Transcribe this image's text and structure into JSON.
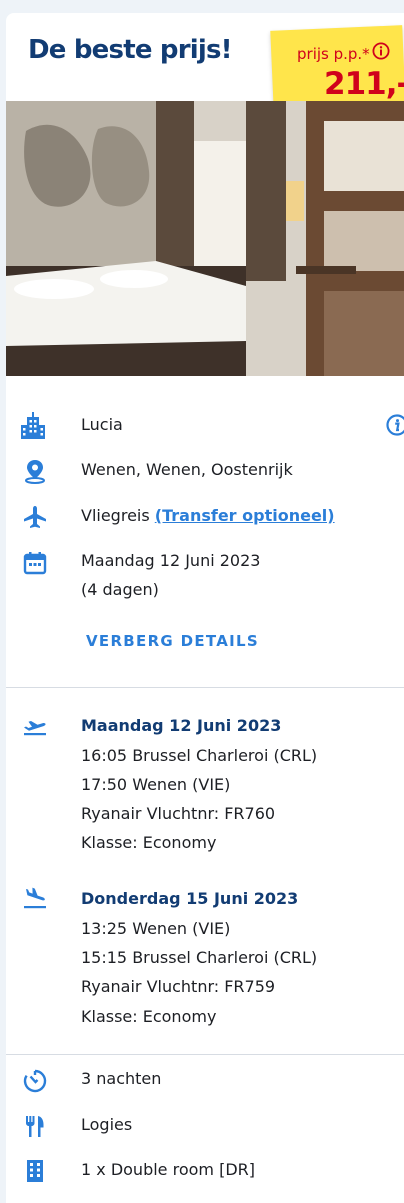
{
  "header": {
    "title": "De beste prijs!",
    "price_label": "prijs p.p.*",
    "price": "211,-"
  },
  "hotel": {
    "name": "Lucia",
    "location": "Wenen, Wenen, Oostenrijk",
    "travel_type": "Vliegreis",
    "transfer_link": "(Transfer optioneel)",
    "date": "Maandag 12 Juni 2023",
    "duration": "(4 dagen)"
  },
  "toggle_label": "VERBERG DETAILS",
  "flights": {
    "outbound": {
      "date": "Maandag 12 Juni 2023",
      "departure": "16:05 Brussel Charleroi (CRL)",
      "arrival": "17:50 Wenen (VIE)",
      "flight": "Ryanair Vluchtnr: FR760",
      "class": "Klasse: Economy"
    },
    "return": {
      "date": "Donderdag 15 Juni 2023",
      "departure": "13:25 Wenen (VIE)",
      "arrival": "15:15 Brussel Charleroi (CRL)",
      "flight": "Ryanair Vluchtnr: FR759",
      "class": "Klasse: Economy"
    }
  },
  "details": {
    "nights": "3 nachten",
    "board": "Logies",
    "room": "1 x Double room [DR]"
  },
  "colors": {
    "navy": "#123c73",
    "accent_blue": "#2b7ed8",
    "price_red": "#d0021b",
    "sticker_yellow": "#ffe54b"
  },
  "icons": [
    "hotel-building-icon",
    "location-pin-icon",
    "airplane-icon",
    "calendar-icon",
    "flight-departure-icon",
    "flight-arrival-icon",
    "timer-icon",
    "cutlery-icon",
    "room-building-icon",
    "info-icon"
  ]
}
